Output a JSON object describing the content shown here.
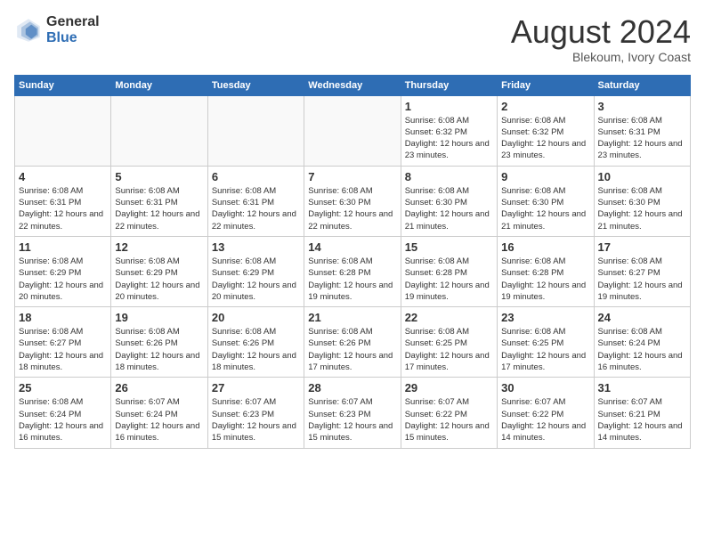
{
  "header": {
    "logo_general": "General",
    "logo_blue": "Blue",
    "month_title": "August 2024",
    "location": "Blekoum, Ivory Coast"
  },
  "weekdays": [
    "Sunday",
    "Monday",
    "Tuesday",
    "Wednesday",
    "Thursday",
    "Friday",
    "Saturday"
  ],
  "weeks": [
    [
      {
        "day": "",
        "sunrise": "",
        "sunset": "",
        "daylight": ""
      },
      {
        "day": "",
        "sunrise": "",
        "sunset": "",
        "daylight": ""
      },
      {
        "day": "",
        "sunrise": "",
        "sunset": "",
        "daylight": ""
      },
      {
        "day": "",
        "sunrise": "",
        "sunset": "",
        "daylight": ""
      },
      {
        "day": "1",
        "sunrise": "Sunrise: 6:08 AM",
        "sunset": "Sunset: 6:32 PM",
        "daylight": "Daylight: 12 hours and 23 minutes."
      },
      {
        "day": "2",
        "sunrise": "Sunrise: 6:08 AM",
        "sunset": "Sunset: 6:32 PM",
        "daylight": "Daylight: 12 hours and 23 minutes."
      },
      {
        "day": "3",
        "sunrise": "Sunrise: 6:08 AM",
        "sunset": "Sunset: 6:31 PM",
        "daylight": "Daylight: 12 hours and 23 minutes."
      }
    ],
    [
      {
        "day": "4",
        "sunrise": "Sunrise: 6:08 AM",
        "sunset": "Sunset: 6:31 PM",
        "daylight": "Daylight: 12 hours and 22 minutes."
      },
      {
        "day": "5",
        "sunrise": "Sunrise: 6:08 AM",
        "sunset": "Sunset: 6:31 PM",
        "daylight": "Daylight: 12 hours and 22 minutes."
      },
      {
        "day": "6",
        "sunrise": "Sunrise: 6:08 AM",
        "sunset": "Sunset: 6:31 PM",
        "daylight": "Daylight: 12 hours and 22 minutes."
      },
      {
        "day": "7",
        "sunrise": "Sunrise: 6:08 AM",
        "sunset": "Sunset: 6:30 PM",
        "daylight": "Daylight: 12 hours and 22 minutes."
      },
      {
        "day": "8",
        "sunrise": "Sunrise: 6:08 AM",
        "sunset": "Sunset: 6:30 PM",
        "daylight": "Daylight: 12 hours and 21 minutes."
      },
      {
        "day": "9",
        "sunrise": "Sunrise: 6:08 AM",
        "sunset": "Sunset: 6:30 PM",
        "daylight": "Daylight: 12 hours and 21 minutes."
      },
      {
        "day": "10",
        "sunrise": "Sunrise: 6:08 AM",
        "sunset": "Sunset: 6:30 PM",
        "daylight": "Daylight: 12 hours and 21 minutes."
      }
    ],
    [
      {
        "day": "11",
        "sunrise": "Sunrise: 6:08 AM",
        "sunset": "Sunset: 6:29 PM",
        "daylight": "Daylight: 12 hours and 20 minutes."
      },
      {
        "day": "12",
        "sunrise": "Sunrise: 6:08 AM",
        "sunset": "Sunset: 6:29 PM",
        "daylight": "Daylight: 12 hours and 20 minutes."
      },
      {
        "day": "13",
        "sunrise": "Sunrise: 6:08 AM",
        "sunset": "Sunset: 6:29 PM",
        "daylight": "Daylight: 12 hours and 20 minutes."
      },
      {
        "day": "14",
        "sunrise": "Sunrise: 6:08 AM",
        "sunset": "Sunset: 6:28 PM",
        "daylight": "Daylight: 12 hours and 19 minutes."
      },
      {
        "day": "15",
        "sunrise": "Sunrise: 6:08 AM",
        "sunset": "Sunset: 6:28 PM",
        "daylight": "Daylight: 12 hours and 19 minutes."
      },
      {
        "day": "16",
        "sunrise": "Sunrise: 6:08 AM",
        "sunset": "Sunset: 6:28 PM",
        "daylight": "Daylight: 12 hours and 19 minutes."
      },
      {
        "day": "17",
        "sunrise": "Sunrise: 6:08 AM",
        "sunset": "Sunset: 6:27 PM",
        "daylight": "Daylight: 12 hours and 19 minutes."
      }
    ],
    [
      {
        "day": "18",
        "sunrise": "Sunrise: 6:08 AM",
        "sunset": "Sunset: 6:27 PM",
        "daylight": "Daylight: 12 hours and 18 minutes."
      },
      {
        "day": "19",
        "sunrise": "Sunrise: 6:08 AM",
        "sunset": "Sunset: 6:26 PM",
        "daylight": "Daylight: 12 hours and 18 minutes."
      },
      {
        "day": "20",
        "sunrise": "Sunrise: 6:08 AM",
        "sunset": "Sunset: 6:26 PM",
        "daylight": "Daylight: 12 hours and 18 minutes."
      },
      {
        "day": "21",
        "sunrise": "Sunrise: 6:08 AM",
        "sunset": "Sunset: 6:26 PM",
        "daylight": "Daylight: 12 hours and 17 minutes."
      },
      {
        "day": "22",
        "sunrise": "Sunrise: 6:08 AM",
        "sunset": "Sunset: 6:25 PM",
        "daylight": "Daylight: 12 hours and 17 minutes."
      },
      {
        "day": "23",
        "sunrise": "Sunrise: 6:08 AM",
        "sunset": "Sunset: 6:25 PM",
        "daylight": "Daylight: 12 hours and 17 minutes."
      },
      {
        "day": "24",
        "sunrise": "Sunrise: 6:08 AM",
        "sunset": "Sunset: 6:24 PM",
        "daylight": "Daylight: 12 hours and 16 minutes."
      }
    ],
    [
      {
        "day": "25",
        "sunrise": "Sunrise: 6:08 AM",
        "sunset": "Sunset: 6:24 PM",
        "daylight": "Daylight: 12 hours and 16 minutes."
      },
      {
        "day": "26",
        "sunrise": "Sunrise: 6:07 AM",
        "sunset": "Sunset: 6:24 PM",
        "daylight": "Daylight: 12 hours and 16 minutes."
      },
      {
        "day": "27",
        "sunrise": "Sunrise: 6:07 AM",
        "sunset": "Sunset: 6:23 PM",
        "daylight": "Daylight: 12 hours and 15 minutes."
      },
      {
        "day": "28",
        "sunrise": "Sunrise: 6:07 AM",
        "sunset": "Sunset: 6:23 PM",
        "daylight": "Daylight: 12 hours and 15 minutes."
      },
      {
        "day": "29",
        "sunrise": "Sunrise: 6:07 AM",
        "sunset": "Sunset: 6:22 PM",
        "daylight": "Daylight: 12 hours and 15 minutes."
      },
      {
        "day": "30",
        "sunrise": "Sunrise: 6:07 AM",
        "sunset": "Sunset: 6:22 PM",
        "daylight": "Daylight: 12 hours and 14 minutes."
      },
      {
        "day": "31",
        "sunrise": "Sunrise: 6:07 AM",
        "sunset": "Sunset: 6:21 PM",
        "daylight": "Daylight: 12 hours and 14 minutes."
      }
    ]
  ]
}
